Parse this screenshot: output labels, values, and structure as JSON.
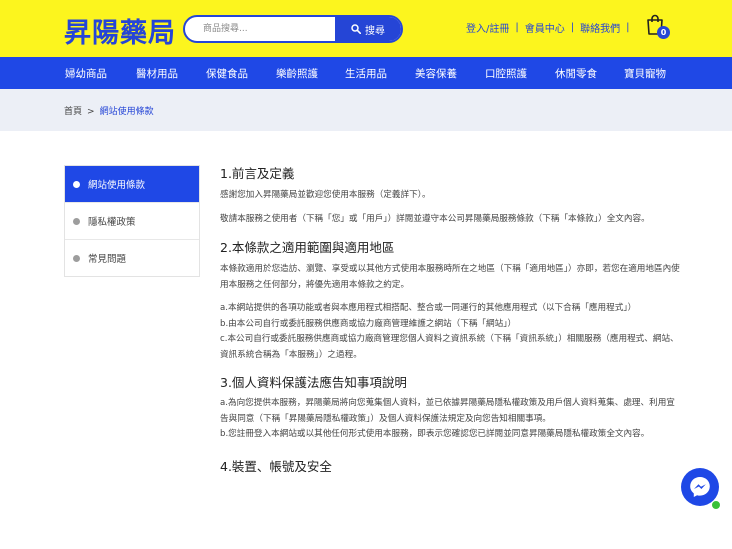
{
  "header": {
    "logo": "昇陽藥局",
    "search": {
      "placeholder": "商品搜尋...",
      "button_label": "搜尋"
    },
    "links": [
      "登入/註冊",
      "會員中心",
      "聯絡我們"
    ],
    "cart_count": "0"
  },
  "nav": [
    "婦幼商品",
    "醫材用品",
    "保健食品",
    "樂齡照護",
    "生活用品",
    "美容保養",
    "口腔照護",
    "休閒零食",
    "寶貝寵物"
  ],
  "breadcrumb": {
    "home": "首頁",
    "separator": ">",
    "current": "網站使用條款"
  },
  "sidebar": {
    "items": [
      {
        "label": "網站使用條款",
        "active": true
      },
      {
        "label": "隱私權政策",
        "active": false
      },
      {
        "label": "常見問題",
        "active": false
      }
    ]
  },
  "content": {
    "s1_title": "1.前言及定義",
    "s1_p1": "感謝您加入昇陽藥局並歡迎您使用本服務（定義詳下）。",
    "s1_p2": "敬請本服務之使用者（下稱「您」或「用戶」）詳閱並遵守本公司昇陽藥局服務條款（下稱「本條款」）全文內容。",
    "s2_title": "2.本條款之適用範圍與適用地區",
    "s2_p1": "本條款適用於您造訪、瀏覽、享受或以其他方式使用本服務時所在之地區（下稱「適用地區」）亦即，若您在適用地區內使用本服務之任何部分，將優先適用本條款之約定。",
    "s2_p2": "a.本網站提供的各項功能或者與本應用程式相搭配、整合或一同運行的其他應用程式（以下合稱「應用程式」）",
    "s2_p3": "b.由本公司自行或委託服務供應商或協力廠商管理維護之網站（下稱「網站」）",
    "s2_p4": "c.本公司自行或委託服務供應商或協力廠商管理您個人資料之資訊系統（下稱「資訊系統」）相關服務（應用程式、網站、資訊系統合稱為「本服務」）之過程。",
    "s3_title": "3.個人資料保護法應告知事項說明",
    "s3_p1": "a.為向您提供本服務，昇陽藥局將向您蒐集個人資料，並已依據昇陽藥局隱私權政策及用戶個人資料蒐集、處理、利用宣告與同意（下稱「昇陽藥局隱私權政策」）及個人資料保護法規定及向您告知相關事項。",
    "s3_p2": "b.您註冊登入本網站或以其他任何形式使用本服務，即表示您確認您已詳閱並同意昇陽藥局隱私權政策全文內容。",
    "s4_title": "4.裝置、帳號及安全"
  },
  "colors": {
    "yellow": "#fcf51e",
    "blue": "#1f48e6",
    "light_bg": "#eceff6",
    "online_green": "#3ac13a"
  }
}
